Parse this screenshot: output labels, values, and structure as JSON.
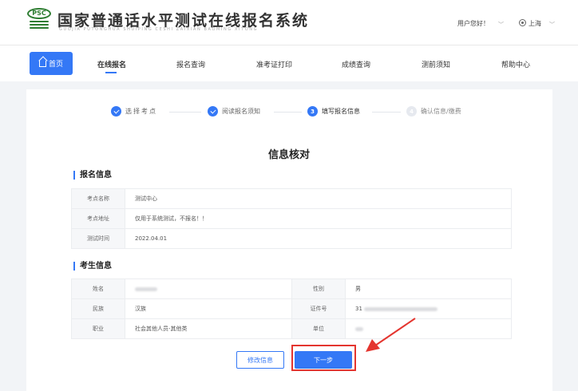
{
  "header": {
    "logo_text": "PSC",
    "title": "国家普通话水平测试在线报名系统",
    "subtitle": "GUOJIA PUTONGHUA SHUIPING CESHI ZAIXIAN BAOMING XITONG",
    "user_greeting": "用户您好！",
    "location": "上海"
  },
  "nav": {
    "home": "首页",
    "items": [
      "在线报名",
      "报名查询",
      "准考证打印",
      "成绩查询",
      "测前须知",
      "帮助中心"
    ]
  },
  "steps": [
    {
      "label": "选择考点",
      "state": "done"
    },
    {
      "label": "阅读报名须知",
      "state": "done"
    },
    {
      "label": "填写报名信息",
      "state": "current",
      "number": "3"
    },
    {
      "label": "确认信息/缴费",
      "state": "pending",
      "number": "4"
    }
  ],
  "page_title": "信息核对",
  "registration": {
    "section_title": "报名信息",
    "rows": [
      {
        "label": "考点名称",
        "value": "测试中心"
      },
      {
        "label": "考点地址",
        "value": "仅用于系统测试，不报名！！"
      },
      {
        "label": "测试时间",
        "value": "2022.04.01"
      }
    ]
  },
  "candidate": {
    "section_title": "考生信息",
    "rows": [
      {
        "label1": "姓名",
        "value1": "",
        "label2": "性别",
        "value2": "男"
      },
      {
        "label1": "民族",
        "value1": "汉族",
        "label2": "证件号",
        "value2": "31"
      },
      {
        "label1": "职业",
        "value1": "社会其他人员-其他类",
        "label2": "单位",
        "value2": ""
      }
    ]
  },
  "buttons": {
    "edit": "修改信息",
    "next": "下一步"
  },
  "colors": {
    "accent": "#3478f6",
    "highlight": "#e4352f",
    "logo_green": "#2e7d32"
  }
}
